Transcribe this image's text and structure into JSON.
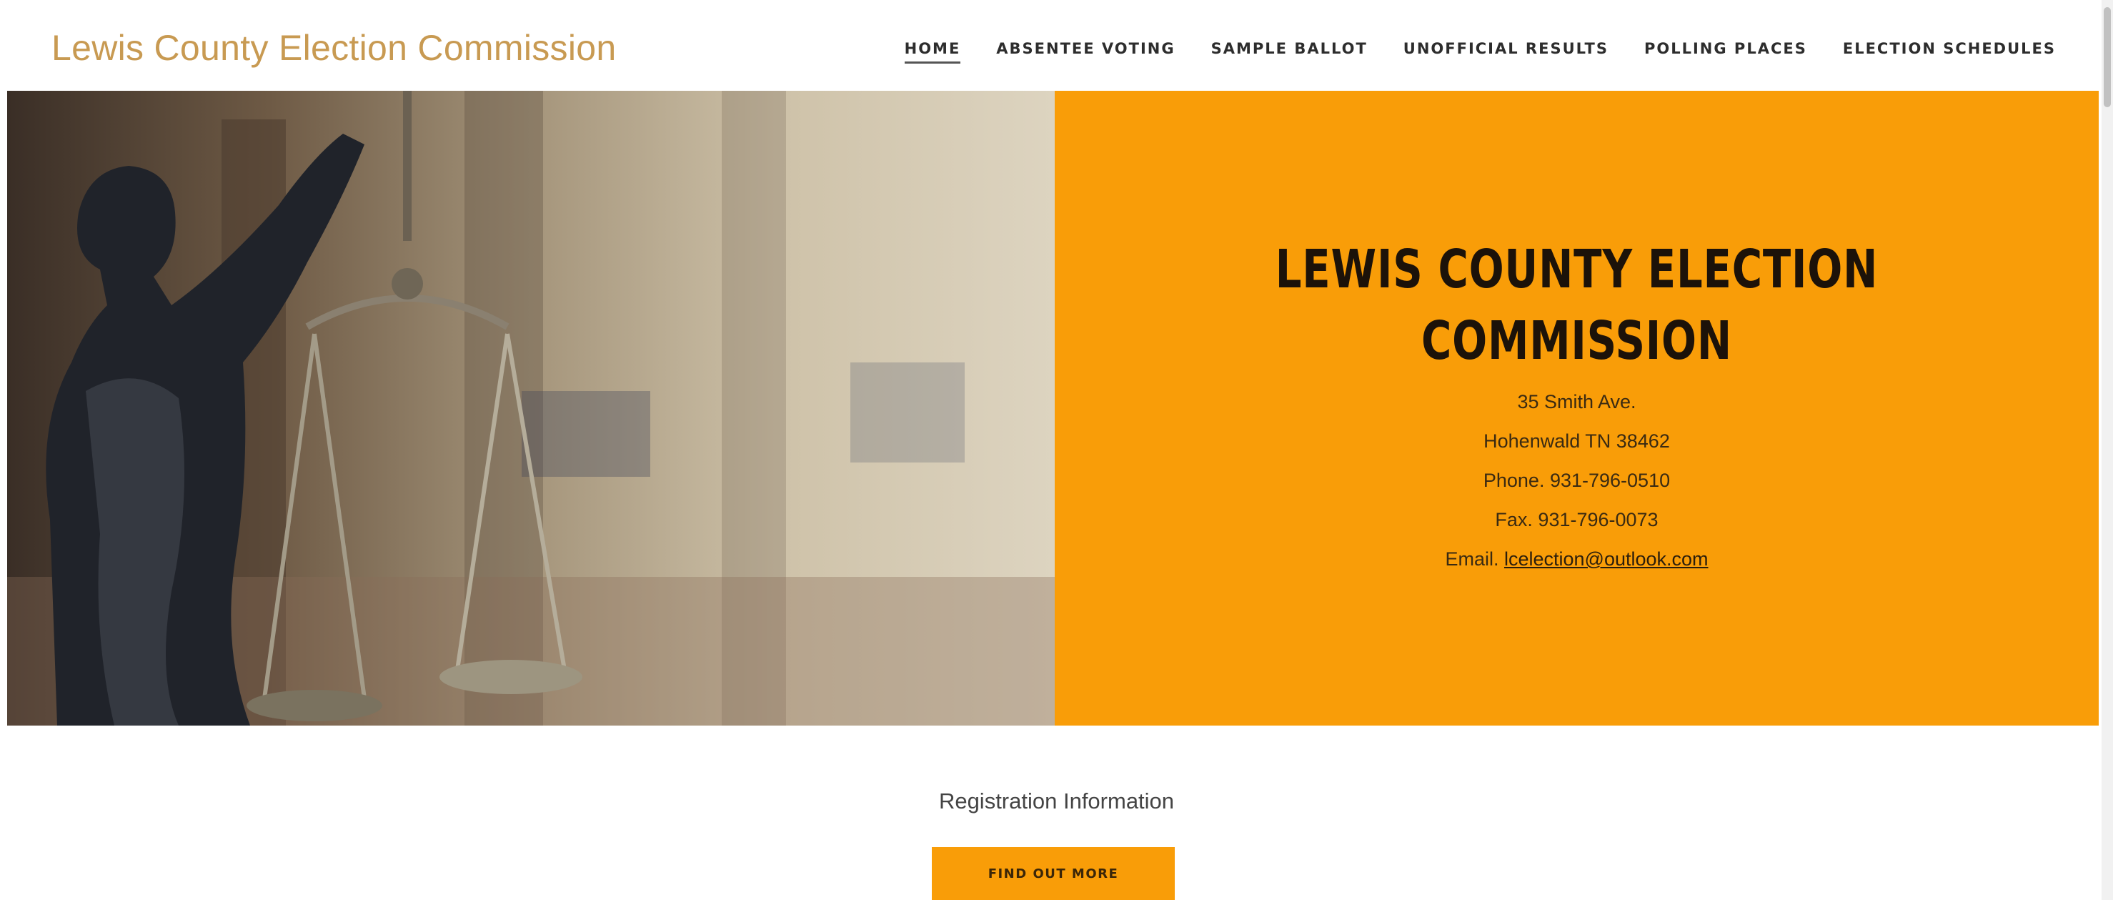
{
  "header": {
    "site_title": "Lewis County Election Commission",
    "nav": [
      {
        "label": "HOME",
        "active": true
      },
      {
        "label": "ABSENTEE VOTING",
        "active": false
      },
      {
        "label": "SAMPLE BALLOT",
        "active": false
      },
      {
        "label": "UNOFFICIAL RESULTS",
        "active": false
      },
      {
        "label": "POLLING PLACES",
        "active": false
      },
      {
        "label": "ELECTION SCHEDULES",
        "active": false
      }
    ]
  },
  "hero": {
    "heading_line1": "LEWIS COUNTY ELECTION",
    "heading_line2": "COMMISSION",
    "address_line1": "35 Smith Ave.",
    "address_line2": "Hohenwald TN 38462",
    "phone": "Phone. 931-796-0510",
    "fax": "Fax. 931-796-0073",
    "email_prefix": "Email. ",
    "email": "lcelection@outlook.com",
    "panel_color": "#f99d08"
  },
  "registration": {
    "title": "Registration Information",
    "button_label": "FIND OUT MORE"
  }
}
